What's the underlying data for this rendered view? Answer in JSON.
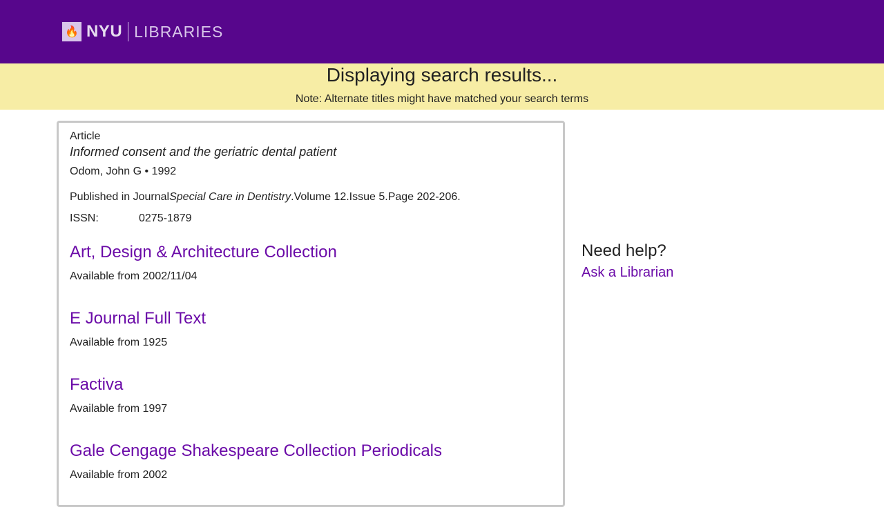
{
  "header": {
    "logo_text": "NYU",
    "logo_sub": "LIBRARIES"
  },
  "banner": {
    "title": "Displaying search results...",
    "note": "Note: Alternate titles might have matched your search terms"
  },
  "record": {
    "type": "Article",
    "title": "Informed consent and the geriatric dental patient",
    "author_year": "Odom, John G • 1992",
    "published_prefix": "Published in Journal",
    "journal": "Special Care in Dentistry",
    "published_suffix": ".Volume 12.Issue 5.Page 202-206.",
    "issn_label": "ISSN:",
    "issn": "0275-1879"
  },
  "results": [
    {
      "name": "Art, Design & Architecture Collection",
      "availability": "Available from 2002/11/04"
    },
    {
      "name": "E Journal Full Text",
      "availability": "Available from 1925"
    },
    {
      "name": "Factiva",
      "availability": "Available from 1997"
    },
    {
      "name": "Gale Cengage Shakespeare Collection Periodicals",
      "availability": "Available from 2002"
    }
  ],
  "sidebar": {
    "heading": "Need help?",
    "link": "Ask a Librarian"
  }
}
